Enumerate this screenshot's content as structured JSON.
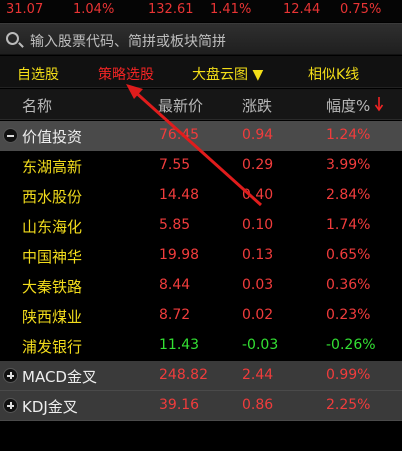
{
  "ticker": [
    {
      "value": "31.07",
      "pct": "1.04%"
    },
    {
      "value": "132.61",
      "pct": "1.41%"
    },
    {
      "value": "12.44",
      "pct": "0.75%"
    }
  ],
  "search": {
    "placeholder": "输入股票代码、简拼或板块简拼"
  },
  "tabs": [
    {
      "label": "自选股"
    },
    {
      "label": "策略选股",
      "active": true
    },
    {
      "label": "大盘云图 ▼"
    },
    {
      "label": "相似K线"
    }
  ],
  "columns": {
    "name": "名称",
    "price": "最新价",
    "change": "涨跌",
    "pct": "幅度%",
    "sort": "descending"
  },
  "groups": [
    {
      "name": "价值投资",
      "price": "76.45",
      "change": "0.94",
      "pct": "1.24%",
      "expanded": true,
      "stocks": [
        {
          "name": "东湖高新",
          "price": "7.55",
          "change": "0.29",
          "pct": "3.99%",
          "dir": "up"
        },
        {
          "name": "西水股份",
          "price": "14.48",
          "change": "0.40",
          "pct": "2.84%",
          "dir": "up"
        },
        {
          "name": "山东海化",
          "price": "5.85",
          "change": "0.10",
          "pct": "1.74%",
          "dir": "up"
        },
        {
          "name": "中国神华",
          "price": "19.98",
          "change": "0.13",
          "pct": "0.65%",
          "dir": "up"
        },
        {
          "name": "大秦铁路",
          "price": "8.44",
          "change": "0.03",
          "pct": "0.36%",
          "dir": "up"
        },
        {
          "name": "陕西煤业",
          "price": "8.72",
          "change": "0.02",
          "pct": "0.23%",
          "dir": "up"
        },
        {
          "name": "浦发银行",
          "price": "11.43",
          "change": "-0.03",
          "pct": "-0.26%",
          "dir": "down"
        }
      ]
    },
    {
      "name": "MACD金叉",
      "price": "248.82",
      "change": "2.44",
      "pct": "0.99%",
      "expanded": false,
      "stocks": []
    },
    {
      "name": "KDJ金叉",
      "price": "39.16",
      "change": "0.86",
      "pct": "2.25%",
      "expanded": false,
      "stocks": []
    }
  ],
  "colors": {
    "up": "#f03c3c",
    "down": "#33e033",
    "stock_name": "#f2dc1c",
    "tab": "#f3de18",
    "tab_active": "#f02424",
    "annotation": "#e01c1c"
  },
  "annotation": {
    "type": "arrow",
    "points_to": "tabs.1"
  }
}
